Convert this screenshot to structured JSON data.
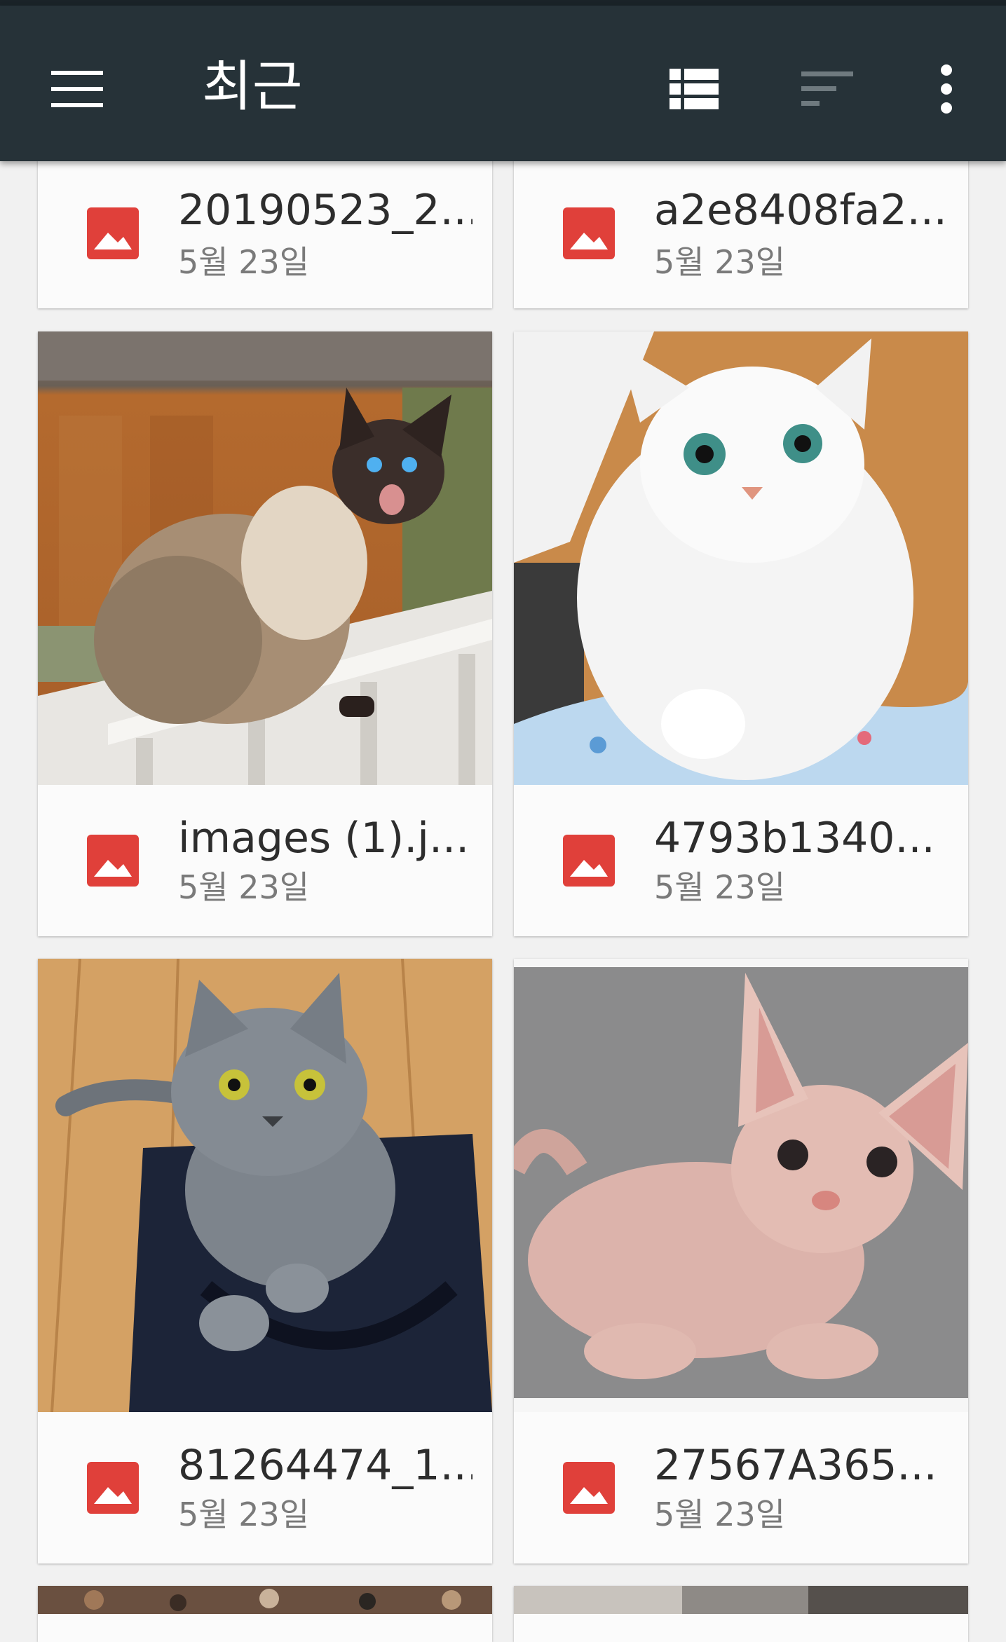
{
  "appbar": {
    "title": "최근",
    "menu_icon": "hamburger-menu-icon",
    "view_icon": "list-view-icon",
    "sort_icon": "sort-icon",
    "more_icon": "more-vert-icon"
  },
  "colors": {
    "appbar_bg": "#263238",
    "image_icon_red": "#e0403a",
    "page_bg": "#f1f1f1"
  },
  "files": [
    {
      "name": "20190523_2...",
      "date": "5월 23일",
      "icon": "image-file-icon"
    },
    {
      "name": "a2e8408fa2...",
      "date": "5월 23일",
      "icon": "image-file-icon"
    },
    {
      "name": "images (1).j...",
      "date": "5월 23일",
      "icon": "image-file-icon",
      "thumbnail": "siamese-cat-on-fence"
    },
    {
      "name": "4793b1340...",
      "date": "5월 23일",
      "icon": "image-file-icon",
      "thumbnail": "white-persian-cat"
    },
    {
      "name": "81264474_1...",
      "date": "5월 23일",
      "icon": "image-file-icon",
      "thumbnail": "gray-russian-blue-cat"
    },
    {
      "name": "27567A365...",
      "date": "5월 23일",
      "icon": "image-file-icon",
      "thumbnail": "sphynx-cat"
    }
  ]
}
